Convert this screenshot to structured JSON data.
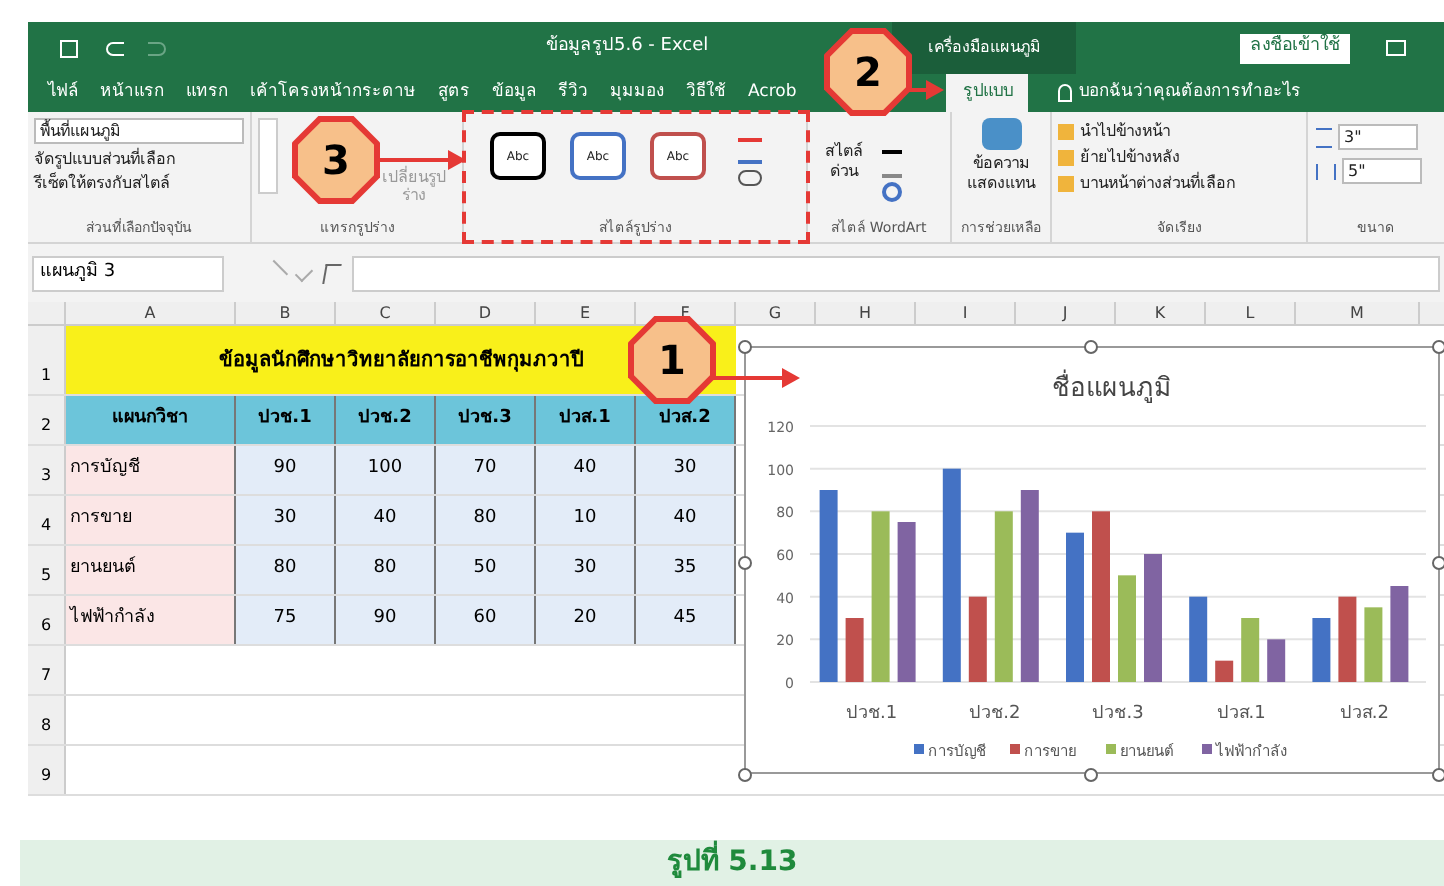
{
  "window": {
    "title": "ข้อมูลรูป5.6 - Excel",
    "context_group": "เครื่องมือแผนภูมิ",
    "sign_in": "ลงชื่อเข้าใช้"
  },
  "tabs": [
    {
      "label": "ไฟล์",
      "selected": false
    },
    {
      "label": "หน้าแรก",
      "selected": false
    },
    {
      "label": "แทรก",
      "selected": false
    },
    {
      "label": "เค้าโครงหน้ากระดาษ",
      "selected": false
    },
    {
      "label": "สูตร",
      "selected": false
    },
    {
      "label": "ข้อมูล",
      "selected": false
    },
    {
      "label": "รีวิว",
      "selected": false
    },
    {
      "label": "มุมมอง",
      "selected": false
    },
    {
      "label": "วิธีใช้",
      "selected": false
    },
    {
      "label": "Acrob",
      "selected": false
    },
    {
      "label": "รูปแบบ",
      "selected": true
    }
  ],
  "tell_me": "บอกฉันว่าคุณต้องการทำอะไร",
  "ribbon": {
    "selection": {
      "dropdown": "พื้นที่แผนภูมิ",
      "format": "จัดรูปแบบส่วนที่เลือก",
      "reset": "รีเซ็ตให้ตรงกับสไตล์",
      "label": "ส่วนที่เลือกปัจจุบัน"
    },
    "insert_shapes": {
      "change_shape": "เปลี่ยนรูปร่าง",
      "label": "แทรกรูปร่าง"
    },
    "shape_styles": {
      "swatches": [
        {
          "text": "Abc",
          "color": "#000000"
        },
        {
          "text": "Abc",
          "color": "#4472c4"
        },
        {
          "text": "Abc",
          "color": "#c0504d"
        }
      ],
      "label": "สไตล์รูปร่าง"
    },
    "wordart": {
      "quick_styles": "สไตล์ด่วน",
      "label": "สไตล์ WordArt"
    },
    "accessibility": {
      "alt_text": "ข้อความแสดงแทน",
      "label": "การช่วยเหลือ"
    },
    "arrange": {
      "items": [
        "นำไปข้างหน้า",
        "ย้ายไปข้างหลัง",
        "บานหน้าต่างส่วนที่เลือก"
      ],
      "label": "จัดเรียง"
    },
    "size": {
      "height": "3\"",
      "width": "5\"",
      "label": "ขนาด"
    }
  },
  "name_box": "แผนภูมิ 3",
  "sheet": {
    "columns": [
      "A",
      "B",
      "C",
      "D",
      "E",
      "F",
      "G",
      "H",
      "I",
      "J",
      "K",
      "L",
      "M"
    ],
    "rows": [
      {
        "number": "1",
        "kind": "title",
        "text": "ข้อมูลนักศึกษาวิทยาลัยการอาชีพกุมภวาปี"
      },
      {
        "number": "2",
        "kind": "header",
        "cells": [
          "แผนกวิชา",
          "ปวช.1",
          "ปวช.2",
          "ปวช.3",
          "ปวส.1",
          "ปวส.2"
        ]
      },
      {
        "number": "3",
        "kind": "data",
        "cells": [
          "การบัญชี",
          "90",
          "100",
          "70",
          "40",
          "30"
        ]
      },
      {
        "number": "4",
        "kind": "data",
        "cells": [
          "การขาย",
          "30",
          "40",
          "80",
          "10",
          "40"
        ]
      },
      {
        "number": "5",
        "kind": "data",
        "cells": [
          "ยานยนต์",
          "80",
          "80",
          "50",
          "30",
          "35"
        ]
      },
      {
        "number": "6",
        "kind": "data",
        "cells": [
          "ไฟฟ้ากำลัง",
          "75",
          "90",
          "60",
          "20",
          "45"
        ]
      },
      {
        "number": "7",
        "kind": "empty"
      },
      {
        "number": "8",
        "kind": "empty"
      },
      {
        "number": "9",
        "kind": "empty"
      }
    ]
  },
  "chart": {
    "chart_data": {
      "type": "bar",
      "title": "ชื่อแผนภูมิ",
      "grid": true,
      "legend": "bottom",
      "categories": [
        "ปวช.1",
        "ปวช.2",
        "ปวช.3",
        "ปวส.1",
        "ปวส.2"
      ],
      "ylim": [
        0,
        120
      ],
      "yticks": [
        {
          "value": 0,
          "label": "0"
        },
        {
          "value": 20,
          "label": "20"
        },
        {
          "value": 40,
          "label": "40"
        },
        {
          "value": 60,
          "label": "60"
        },
        {
          "value": 80,
          "label": "80"
        },
        {
          "value": 100,
          "label": "100"
        },
        {
          "value": 120,
          "label": "120"
        }
      ],
      "series": [
        {
          "name": "การบัญชี",
          "color": "#4472c4",
          "values": [
            90,
            100,
            70,
            40,
            30
          ]
        },
        {
          "name": "การขาย",
          "color": "#c0504d",
          "values": [
            30,
            40,
            80,
            10,
            40
          ]
        },
        {
          "name": "ยานยนต์",
          "color": "#9bbb59",
          "values": [
            80,
            80,
            50,
            30,
            35
          ]
        },
        {
          "name": "ไฟฟ้ากำลัง",
          "color": "#8064a2",
          "values": [
            75,
            90,
            60,
            20,
            45
          ]
        }
      ]
    }
  },
  "callouts": [
    {
      "number": "1"
    },
    {
      "number": "2"
    },
    {
      "number": "3"
    }
  ],
  "caption": "รูปที่ 5.13"
}
